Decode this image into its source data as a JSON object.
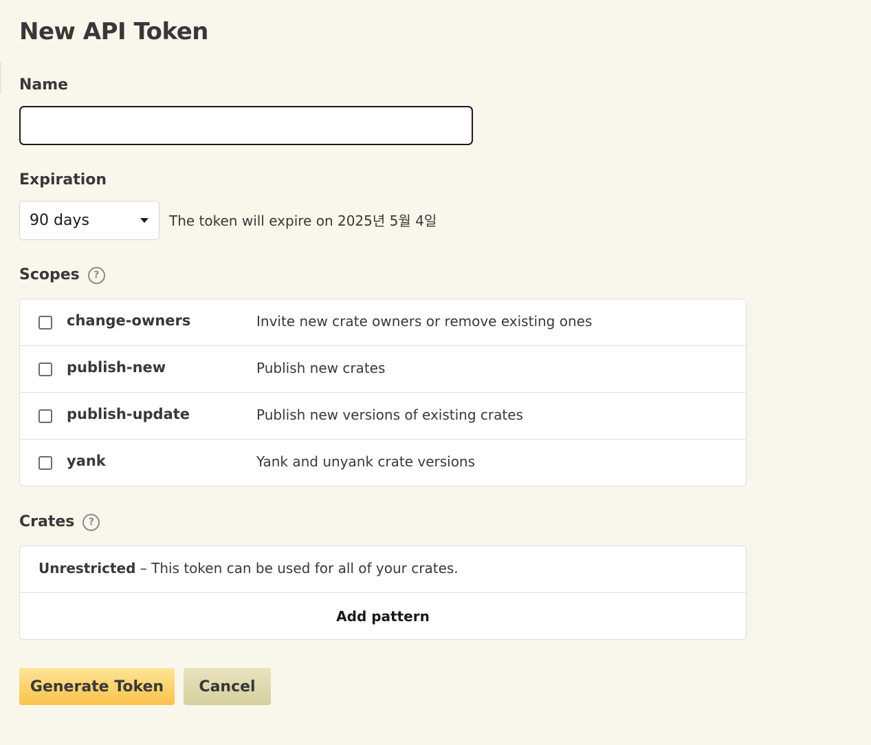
{
  "page": {
    "title": "New API Token"
  },
  "name_field": {
    "label": "Name",
    "value": "",
    "placeholder": ""
  },
  "expiration": {
    "label": "Expiration",
    "selected": "90 days",
    "note": "The token will expire on 2025년 5월 4일"
  },
  "scopes": {
    "label": "Scopes",
    "help_icon": "question-circle-icon",
    "help_glyph": "?",
    "items": [
      {
        "name": "change-owners",
        "description": "Invite new crate owners or remove existing ones",
        "checked": false
      },
      {
        "name": "publish-new",
        "description": "Publish new crates",
        "checked": false
      },
      {
        "name": "publish-update",
        "description": "Publish new versions of existing crates",
        "checked": false
      },
      {
        "name": "yank",
        "description": "Yank and unyank crate versions",
        "checked": false
      }
    ]
  },
  "crates": {
    "label": "Crates",
    "help_icon": "question-circle-icon",
    "help_glyph": "?",
    "restriction_title": "Unrestricted",
    "restriction_text": " – This token can be used for all of your crates.",
    "add_pattern_label": "Add pattern"
  },
  "actions": {
    "generate_label": "Generate Token",
    "cancel_label": "Cancel"
  },
  "colors": {
    "background": "#f9f7ec",
    "primary_button": "#fcc24c",
    "secondary_button": "#d6cf9f",
    "text": "#383838"
  }
}
